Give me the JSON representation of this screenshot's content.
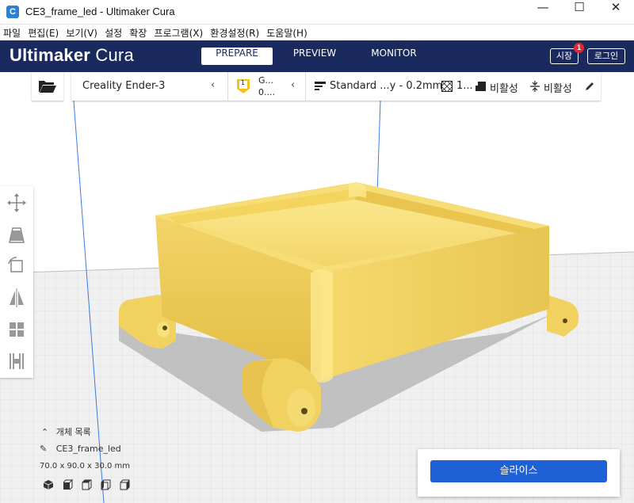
{
  "window": {
    "title": "CE3_frame_led - Ultimaker Cura",
    "app_icon_glyph": "C",
    "minimize_glyph": "—",
    "maximize_glyph": "☐",
    "close_glyph": "✕"
  },
  "menu": [
    "파일",
    "편집(E)",
    "보기(V)",
    "설정",
    "확장",
    "프로그램(X)",
    "환경설정(R)",
    "도움말(H)"
  ],
  "header": {
    "logo_bold": "Ultimaker",
    "logo_light": " Cura",
    "stages": [
      "PREPARE",
      "PREVIEW",
      "MONITOR"
    ],
    "active_stage": "PREPARE",
    "marketplace_label": "시장",
    "marketplace_badge": "1",
    "login_label": "로그인"
  },
  "printer_bar": {
    "printer_name": "Creality Ender-3",
    "extruder_number": "1",
    "material_line1": "G...",
    "material_line2": "0....",
    "profile": "Standard ...y - 0.2mm",
    "infill_value": "1...",
    "support_label": "비활성",
    "adhesion_label": "비활성"
  },
  "object_list": {
    "toggle_label": "개체 목록",
    "object_name": "CE3_frame_led",
    "dimensions": "70.0 x 90.0 x 30.0 mm"
  },
  "slice": {
    "button_label": "슬라이스"
  },
  "colors": {
    "header_bg": "#1b2a5e",
    "accent_blue": "#1e61d6",
    "model_yellow": "#f7dc6f",
    "badge_red": "#e0292e"
  },
  "icons": {
    "open": "folder-open-icon",
    "tools": [
      "move-tool-icon",
      "scale-tool-icon",
      "rotate-tool-icon",
      "mirror-tool-icon",
      "per-model-settings-icon",
      "support-blocker-icon"
    ],
    "views": [
      "view-3d-icon",
      "view-front-icon",
      "view-top-icon",
      "view-left-icon",
      "view-right-icon"
    ]
  }
}
